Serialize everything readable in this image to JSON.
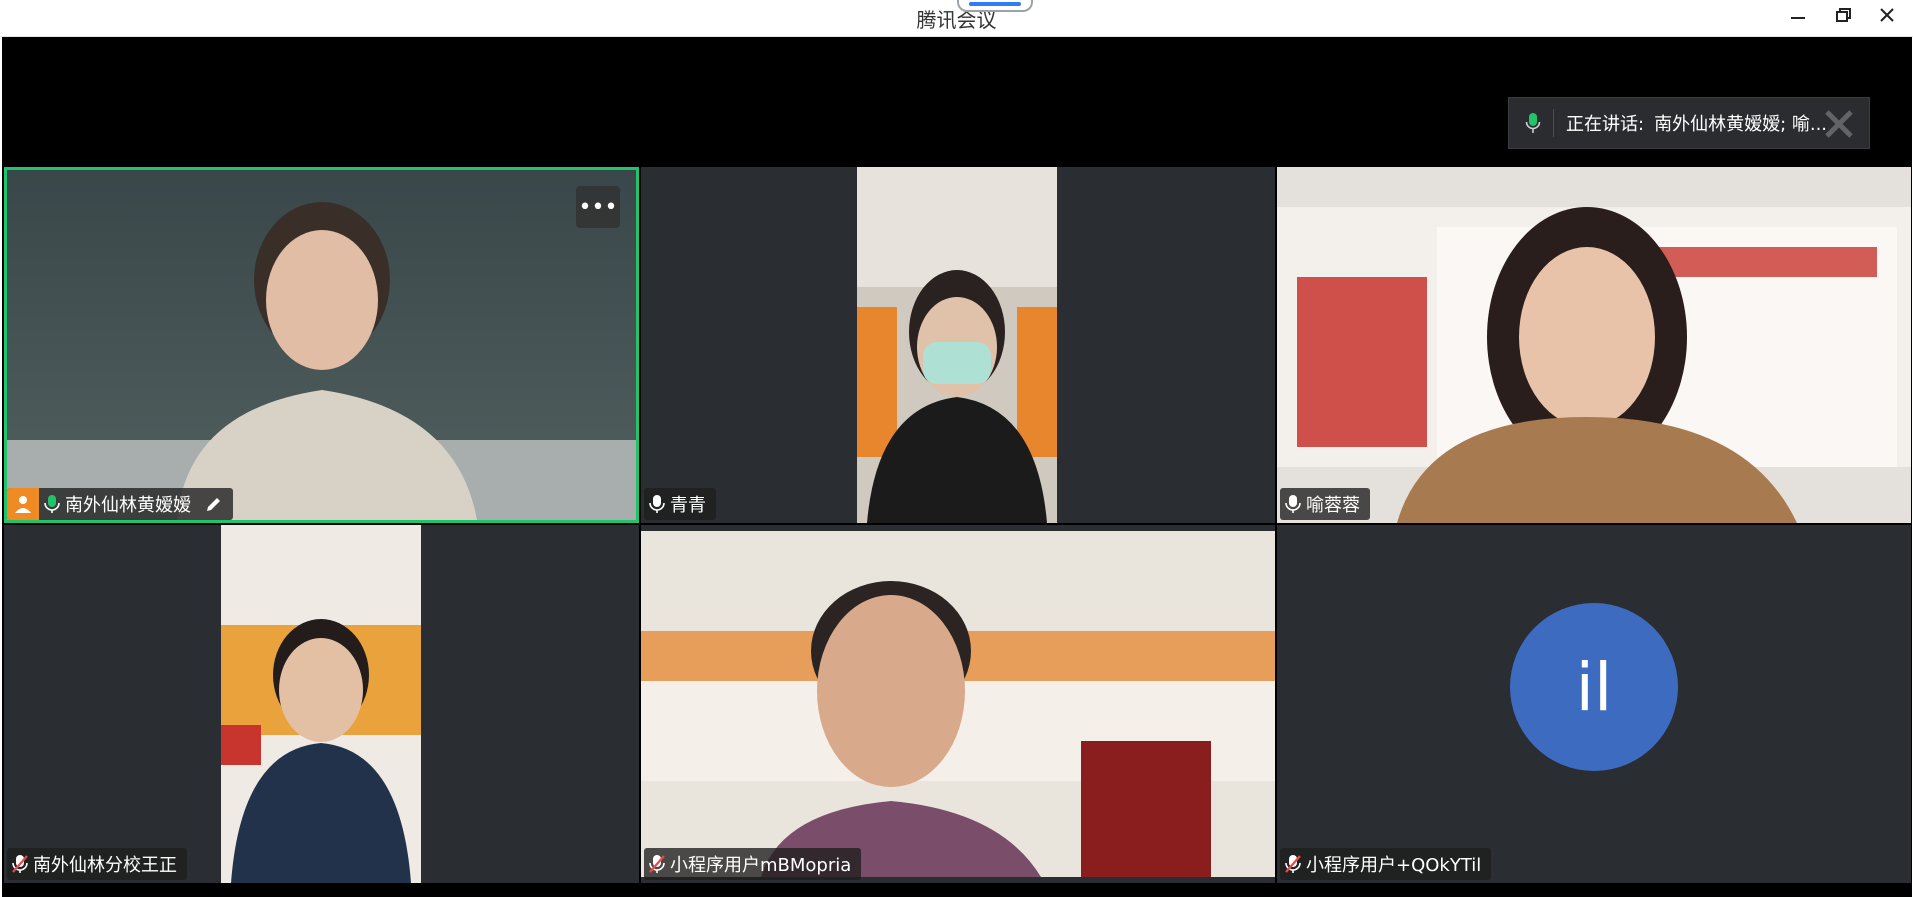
{
  "window": {
    "title": "腾讯会议"
  },
  "speaking": {
    "label": "正在讲话:",
    "names": "南外仙林黄嫒嫒; 喻..."
  },
  "participants": [
    {
      "name": "南外仙林黄嫒嫒",
      "mic": "on",
      "host": true
    },
    {
      "name": "青青",
      "mic": "on"
    },
    {
      "name": "喻蓉蓉",
      "mic": "on"
    },
    {
      "name": "南外仙林分校王正",
      "mic": "muted"
    },
    {
      "name": "小程序用户mBMopria",
      "mic": "muted"
    },
    {
      "name": "小程序用户+QOkYTil",
      "mic": "muted",
      "avatar_text": "il"
    }
  ],
  "colors": {
    "active_speaker_border": "#1fc46b",
    "host_badge": "#f08a23",
    "avatar_bg": "#3d6bc0",
    "muted_mic": "#e84a4a",
    "active_mic": "#1fc46b"
  },
  "icons": {
    "minimize": "minimize-icon",
    "maximize": "restore-icon",
    "close": "close-icon",
    "more": "more-options-icon",
    "mic": "microphone-icon",
    "mic_muted": "microphone-muted-icon",
    "host": "host-icon",
    "rename": "pencil-icon"
  }
}
